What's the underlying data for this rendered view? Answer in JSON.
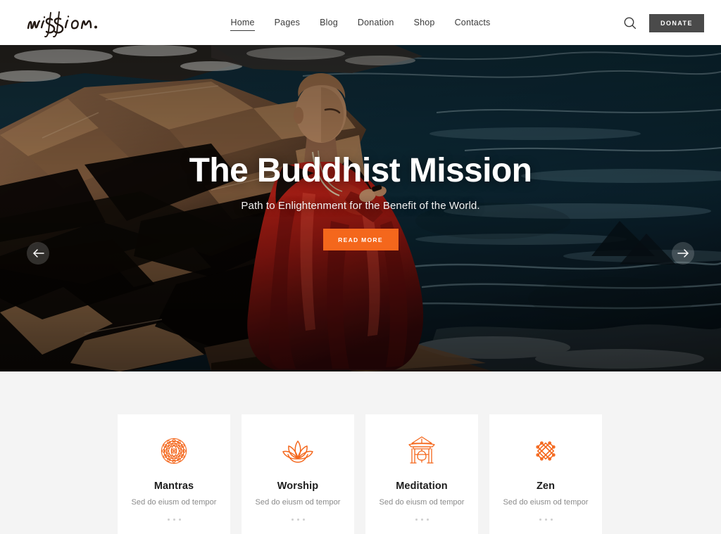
{
  "site": {
    "logo_text": "mission.",
    "accent_color": "#f4671c",
    "dark_color": "#4a4a4a",
    "page_bg": "#f4f4f4"
  },
  "header": {
    "nav": [
      {
        "label": "Home",
        "active": true
      },
      {
        "label": "Pages",
        "active": false
      },
      {
        "label": "Blog",
        "active": false
      },
      {
        "label": "Donation",
        "active": false
      },
      {
        "label": "Shop",
        "active": false
      },
      {
        "label": "Contacts",
        "active": false
      }
    ],
    "search_icon": "search-icon",
    "donate_label": "DONATE"
  },
  "hero": {
    "title": "The Buddhist Mission",
    "subtitle": "Path to Enlightenment for the Benefit of the World.",
    "cta_label": "READ MORE",
    "prev_icon": "arrow-left-icon",
    "next_icon": "arrow-right-icon",
    "image_alt": "Buddhist monk in red robes seated on rocks beside dark water"
  },
  "features": {
    "cards": [
      {
        "icon": "mandala-icon",
        "title": "Mantras",
        "desc": "Sed do eiusm od tempor"
      },
      {
        "icon": "lotus-icon",
        "title": "Worship",
        "desc": "Sed do eiusm od tempor"
      },
      {
        "icon": "temple-gate-icon",
        "title": "Meditation",
        "desc": "Sed do eiusm od tempor"
      },
      {
        "icon": "endless-knot-icon",
        "title": "Zen",
        "desc": "Sed do eiusm od tempor"
      }
    ]
  }
}
